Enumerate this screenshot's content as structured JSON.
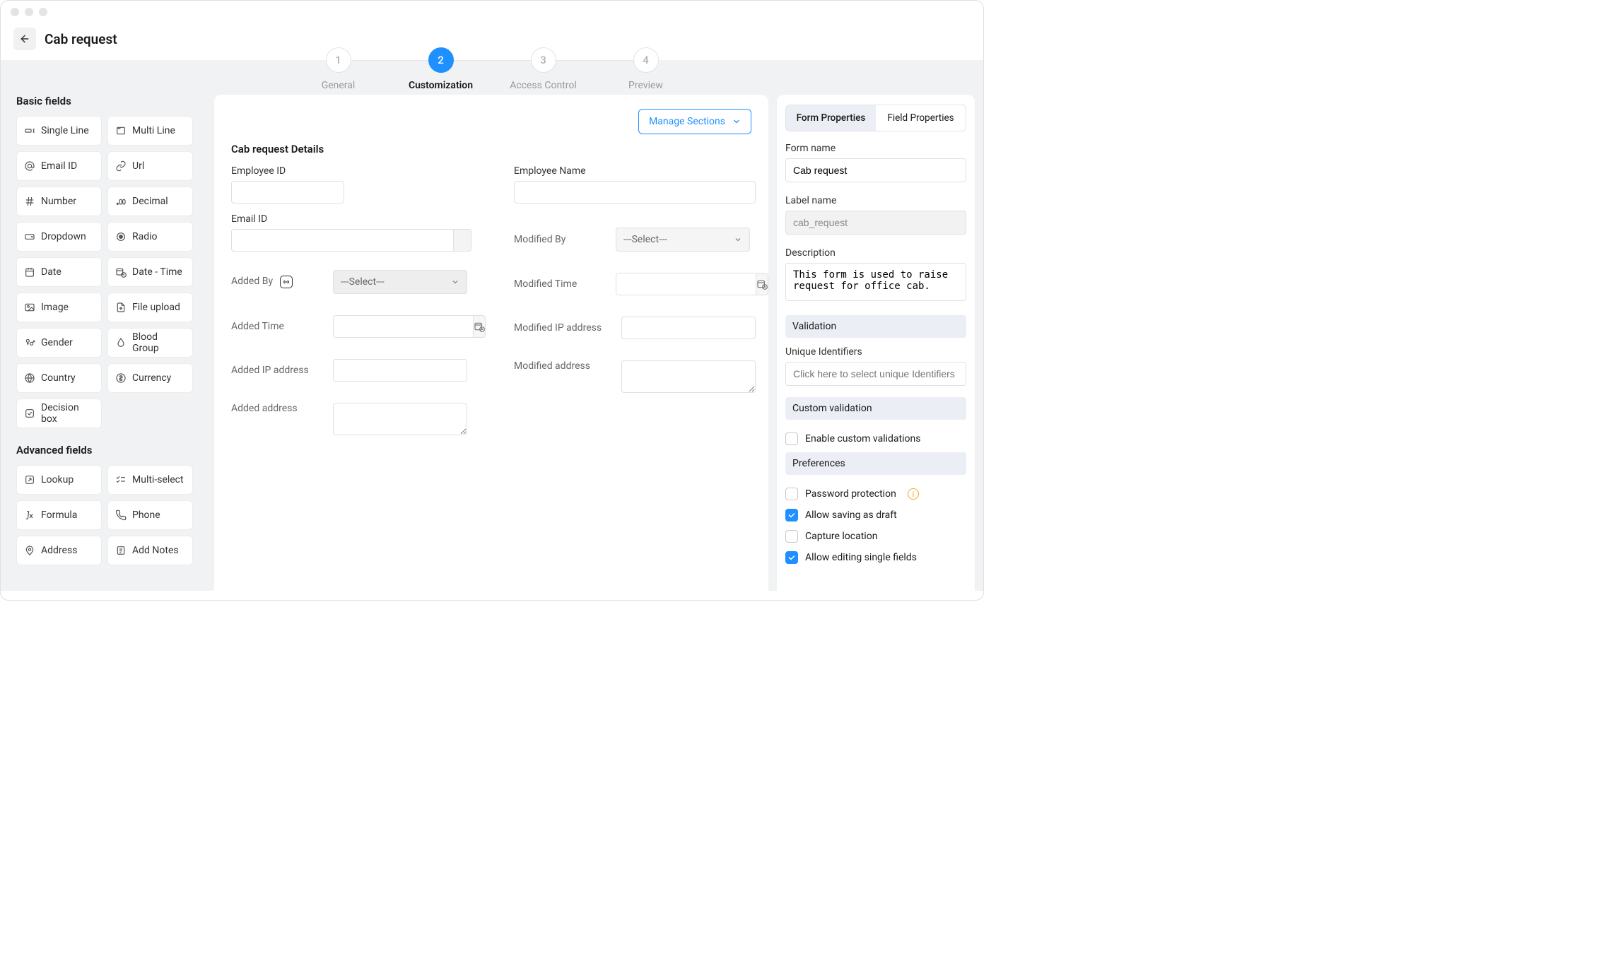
{
  "page": {
    "title": "Cab request"
  },
  "stepper": {
    "steps": [
      {
        "num": "1",
        "label": "General",
        "active": false
      },
      {
        "num": "2",
        "label": "Customization",
        "active": true
      },
      {
        "num": "3",
        "label": "Access Control",
        "active": false
      },
      {
        "num": "4",
        "label": "Preview",
        "active": false
      }
    ]
  },
  "basic": {
    "heading": "Basic fields",
    "items": [
      "Single Line",
      "Multi Line",
      "Email ID",
      "Url",
      "Number",
      "Decimal",
      "Dropdown",
      "Radio",
      "Date",
      "Date - Time",
      "Image",
      "File upload",
      "Gender",
      "Blood Group",
      "Country",
      "Currency",
      "Decision box"
    ]
  },
  "advanced": {
    "heading": "Advanced fields",
    "items": [
      "Lookup",
      "Multi-select",
      "Formula",
      "Phone",
      "Address",
      "Add Notes"
    ]
  },
  "builder": {
    "manage": "Manage Sections",
    "section_title": "Cab request Details",
    "left_fields": {
      "employee_id": "Employee ID",
      "email_id": "Email ID",
      "added_by": "Added By",
      "added_time": "Added Time",
      "added_ip": "Added IP address",
      "added_addr": "Added address"
    },
    "right_fields": {
      "employee_name": "Employee Name",
      "modified_by": "Modified By",
      "modified_time": "Modified Time",
      "modified_ip": "Modified IP address",
      "modified_addr": "Modified address"
    },
    "select_placeholder": "---Select---"
  },
  "props": {
    "tabs": {
      "form": "Form Properties",
      "field": "Field Properties"
    },
    "form_name_label": "Form name",
    "form_name_value": "Cab request",
    "label_name_label": "Label name",
    "label_name_value": "cab_request",
    "desc_label": "Description",
    "desc_value": "This form is used to raise request for office cab.",
    "validation": "Validation",
    "uid_label": "Unique Identifiers",
    "uid_placeholder": "Click here to select unique Identifiers",
    "custom_validation": "Custom validation",
    "enable_custom": "Enable custom validations",
    "preferences": "Preferences",
    "pref_items": [
      {
        "label": "Password protection",
        "checked": false,
        "info": true
      },
      {
        "label": "Allow saving as draft",
        "checked": true
      },
      {
        "label": "Capture location",
        "checked": false
      },
      {
        "label": "Allow editing single fields",
        "checked": true
      }
    ]
  }
}
